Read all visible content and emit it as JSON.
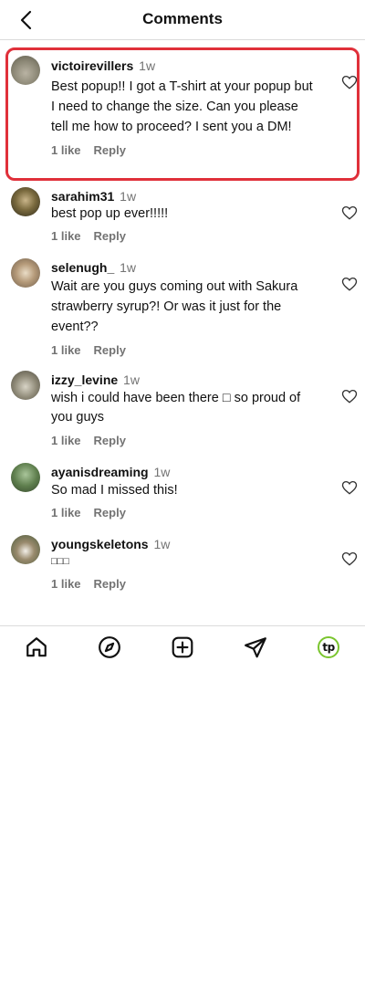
{
  "header": {
    "title": "Comments",
    "back_icon": "chevron-left-icon"
  },
  "comments": [
    {
      "username": "victoirevillers",
      "time": "1w",
      "text": "Best popup!! I got a T-shirt at your popup but I need to change the size. Can you please tell me how to proceed? I sent you a DM!",
      "likes": "1 like",
      "reply": "Reply",
      "highlighted": true
    },
    {
      "username": "sarahim31",
      "time": "1w",
      "text": "best pop up ever!!!!!",
      "likes": "1 like",
      "reply": "Reply"
    },
    {
      "username": "selenugh_",
      "time": "1w",
      "text": "Wait are you guys coming out with Sakura strawberry syrup?! Or was it just for the event??",
      "likes": "1 like",
      "reply": "Reply"
    },
    {
      "username": "izzy_levine",
      "time": "1w",
      "text": "wish i could have been there □ so proud of you guys",
      "likes": "1 like",
      "reply": "Reply"
    },
    {
      "username": "ayanisdreaming",
      "time": "1w",
      "text": "So mad I missed this!",
      "likes": "1 like",
      "reply": "Reply"
    },
    {
      "username": "youngskeletons",
      "time": "1w",
      "text": "□□□",
      "likes": "1 like",
      "reply": "Reply"
    }
  ],
  "tabbar": {
    "items": [
      "home-icon",
      "explore-icon",
      "create-icon",
      "direct-message-icon",
      "profile-icon"
    ],
    "profile_logo_text": "tp",
    "accent": "#7ac52e"
  },
  "colors": {
    "highlight": "#e0303a",
    "muted": "#737373",
    "divider": "#dbdbdb"
  }
}
